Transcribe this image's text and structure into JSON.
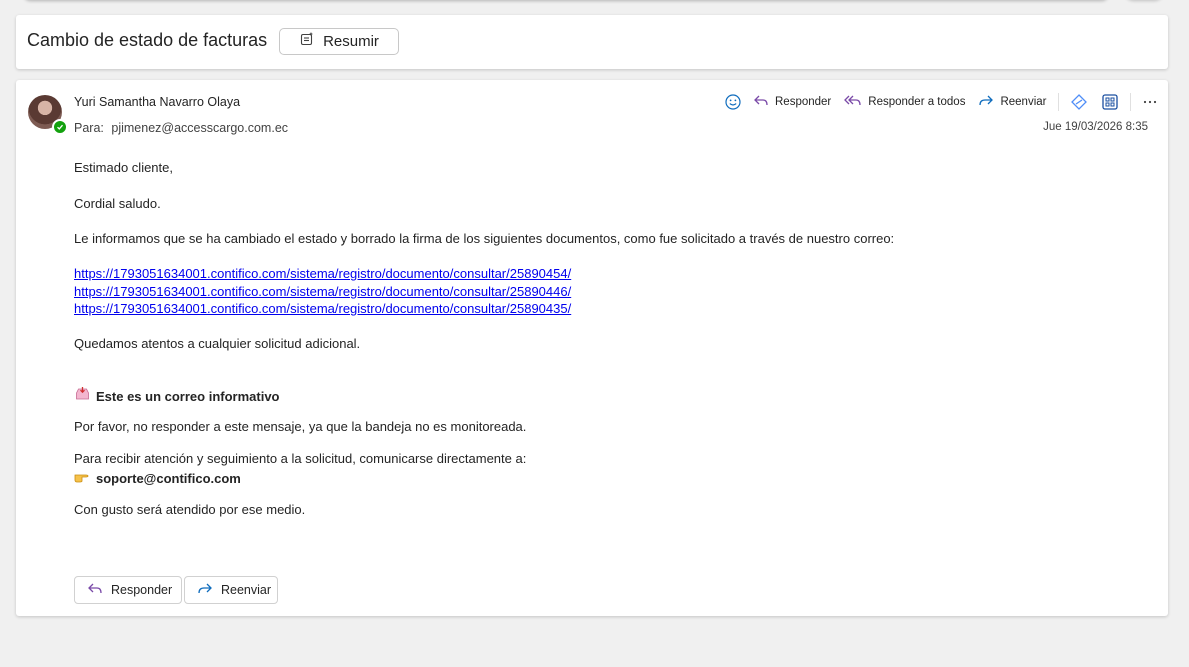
{
  "subject": {
    "title": "Cambio de estado de facturas",
    "summarize_label": "Resumir"
  },
  "message": {
    "sender": "Yuri Samantha Navarro Olaya",
    "to_label": "Para:",
    "to_address": "pjimenez@accesscargo.com.ec",
    "date": "Jue 19/03/2026 8:35",
    "actions": {
      "reply": "Responder",
      "reply_all": "Responder a todos",
      "forward": "Reenviar"
    },
    "body": {
      "greeting": "Estimado cliente,",
      "salutation": "Cordial saludo.",
      "intro": "Le informamos que se ha cambiado el estado y borrado la firma de los siguientes documentos, como fue solicitado a través de nuestro correo:",
      "links": [
        "https://1793051634001.contifico.com/sistema/registro/documento/consultar/25890454/",
        "https://1793051634001.contifico.com/sistema/registro/documento/consultar/25890446/",
        "https://1793051634001.contifico.com/sistema/registro/documento/consultar/25890435/"
      ],
      "closing": "Quedamos atentos a cualquier solicitud adicional.",
      "notice_title": "Este es un correo informativo",
      "notice_text": "Por favor, no responder a este mensaje, ya que la bandeja no es monitoreada.",
      "contact_text": "Para recibir atención y seguimiento a la solicitud, comunicarse directamente a:",
      "contact_email": "soporte@contifico.com",
      "final": "Con gusto será atendido por ese medio."
    },
    "footer": {
      "reply": "Responder",
      "forward": "Reenviar"
    }
  },
  "colors": {
    "link": "#0000ee",
    "presence": "#13a10e",
    "icon_blue": "#0f6cbd",
    "icon_purple": "#7a4aa8"
  }
}
